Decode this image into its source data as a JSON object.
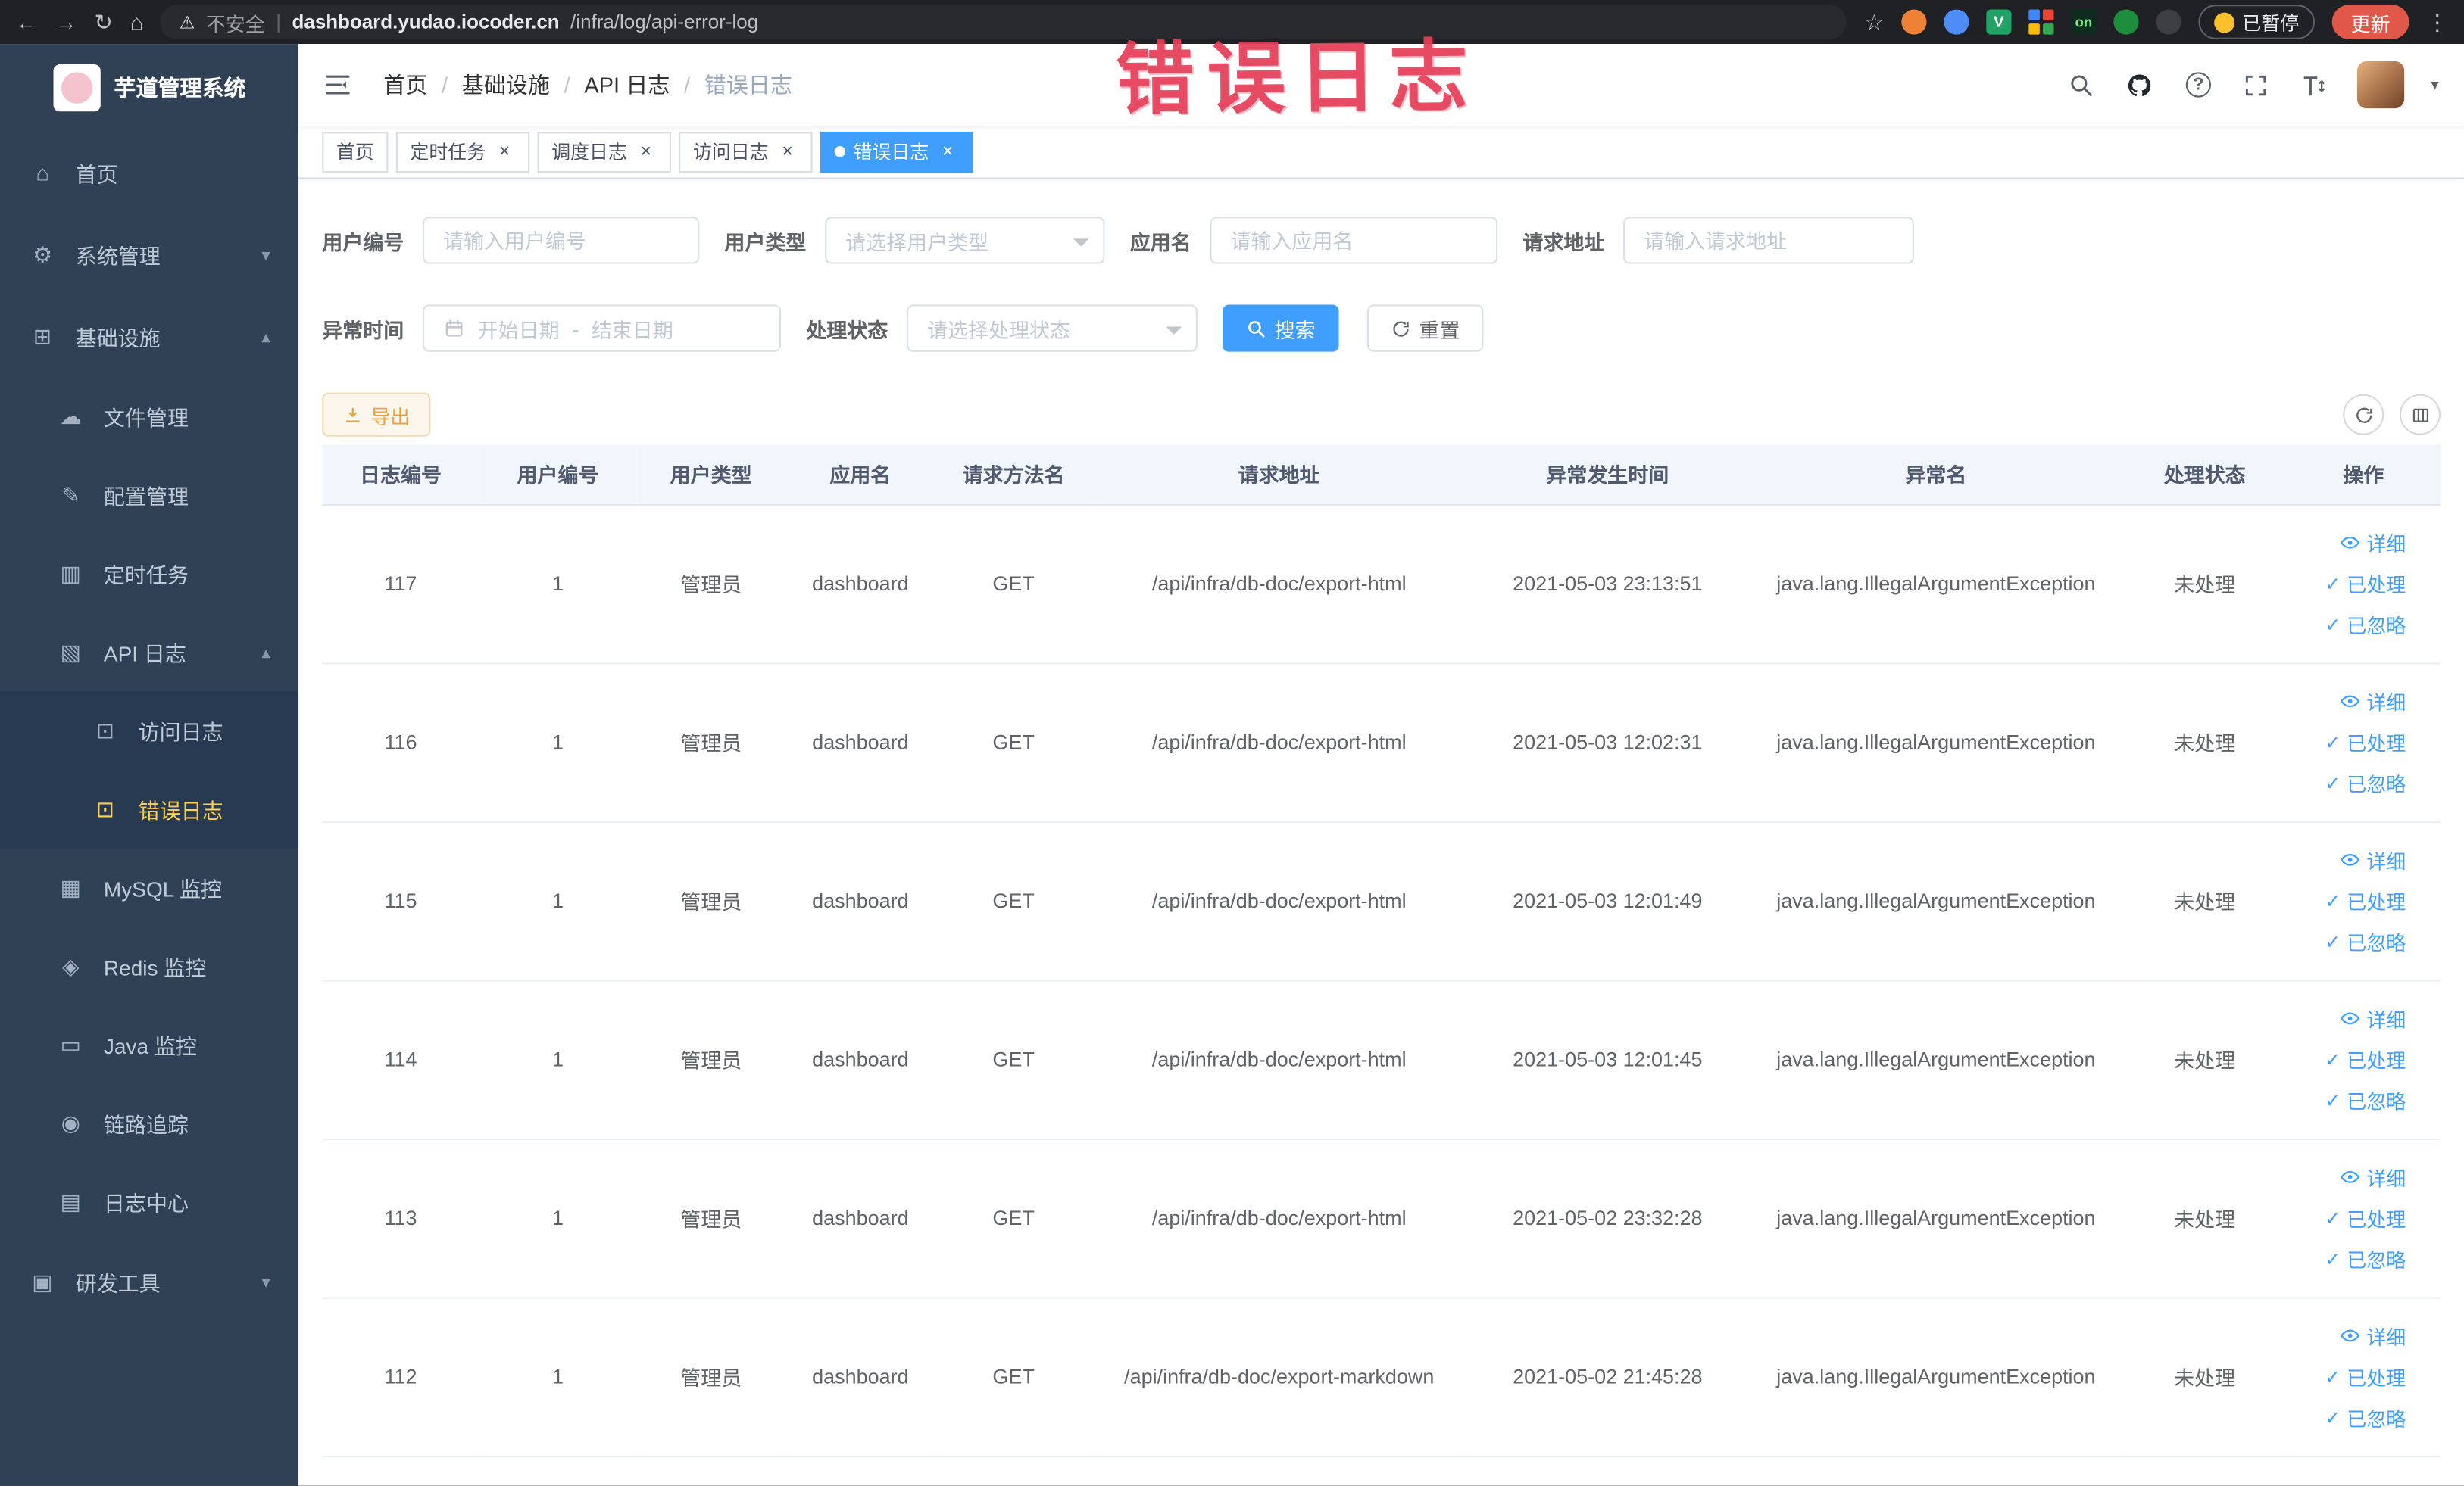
{
  "browser": {
    "security_label": "不安全",
    "divider": "|",
    "url_domain": "dashboard.yudao.iocoder.cn",
    "url_path": "/infra/log/api-error-log",
    "vue_badge": "V",
    "on_badge": "on",
    "paused_badge": "已暂停",
    "update_button": "更新"
  },
  "icons": {
    "back": "←",
    "forward": "→",
    "reload": "↻",
    "home": "⌂",
    "warning": "⚠",
    "star": "☆",
    "more": "⋮",
    "question": "?",
    "chevron_down": "▾",
    "chevron_up": "▴",
    "close": "×",
    "check": "✓",
    "caret_down": "▾",
    "menu_home": "⌂",
    "menu_system": "⚙",
    "menu_infra": "⊞",
    "menu_file": "☁",
    "menu_config": "✎",
    "menu_cron": "▥",
    "menu_api": "▧",
    "menu_doc": "⊡",
    "menu_mysql": "▦",
    "menu_redis": "◈",
    "menu_java": "▭",
    "menu_trace": "◉",
    "menu_log": "▤",
    "menu_dev": "▣"
  },
  "sidebar": {
    "title": "芋道管理系统",
    "items": {
      "home": "首页",
      "system": "系统管理",
      "infra": "基础设施",
      "file": "文件管理",
      "config": "配置管理",
      "cron": "定时任务",
      "api_log": "API 日志",
      "access_log": "访问日志",
      "error_log": "错误日志",
      "mysql": "MySQL 监控",
      "redis": "Redis 监控",
      "java": "Java 监控",
      "trace": "链路追踪",
      "log_center": "日志中心",
      "dev_tools": "研发工具"
    }
  },
  "breadcrumb": {
    "sep": "/",
    "items": [
      "首页",
      "基础设施",
      "API 日志",
      "错误日志"
    ]
  },
  "annotation": {
    "text": "错误日志"
  },
  "tabs": [
    {
      "label": "首页"
    },
    {
      "label": "定时任务"
    },
    {
      "label": "调度日志"
    },
    {
      "label": "访问日志"
    },
    {
      "label": "错误日志"
    }
  ],
  "filters": {
    "user_id_label": "用户编号",
    "user_id_ph": "请输入用户编号",
    "user_type_label": "用户类型",
    "user_type_ph": "请选择用户类型",
    "app_name_label": "应用名",
    "app_name_ph": "请输入应用名",
    "req_url_label": "请求地址",
    "req_url_ph": "请输入请求地址",
    "time_label": "异常时间",
    "time_start_ph": "开始日期",
    "time_sep": "-",
    "time_end_ph": "结束日期",
    "status_label": "处理状态",
    "status_ph": "请选择处理状态",
    "search_label": "搜索",
    "reset_label": "重置"
  },
  "toolbar": {
    "export_label": "导出"
  },
  "table": {
    "columns": [
      "日志编号",
      "用户编号",
      "用户类型",
      "应用名",
      "请求方法名",
      "请求地址",
      "异常发生时间",
      "异常名",
      "处理状态",
      "操作"
    ],
    "rows": [
      {
        "id": "117",
        "user_id": "1",
        "user_type": "管理员",
        "app": "dashboard",
        "method": "GET",
        "url": "/api/infra/db-doc/export-html",
        "time": "2021-05-03 23:13:51",
        "exception": "java.lang.IllegalArgumentException",
        "status": "未处理"
      },
      {
        "id": "116",
        "user_id": "1",
        "user_type": "管理员",
        "app": "dashboard",
        "method": "GET",
        "url": "/api/infra/db-doc/export-html",
        "time": "2021-05-03 12:02:31",
        "exception": "java.lang.IllegalArgumentException",
        "status": "未处理"
      },
      {
        "id": "115",
        "user_id": "1",
        "user_type": "管理员",
        "app": "dashboard",
        "method": "GET",
        "url": "/api/infra/db-doc/export-html",
        "time": "2021-05-03 12:01:49",
        "exception": "java.lang.IllegalArgumentException",
        "status": "未处理"
      },
      {
        "id": "114",
        "user_id": "1",
        "user_type": "管理员",
        "app": "dashboard",
        "method": "GET",
        "url": "/api/infra/db-doc/export-html",
        "time": "2021-05-03 12:01:45",
        "exception": "java.lang.IllegalArgumentException",
        "status": "未处理"
      },
      {
        "id": "113",
        "user_id": "1",
        "user_type": "管理员",
        "app": "dashboard",
        "method": "GET",
        "url": "/api/infra/db-doc/export-html",
        "time": "2021-05-02 23:32:28",
        "exception": "java.lang.IllegalArgumentException",
        "status": "未处理"
      },
      {
        "id": "112",
        "user_id": "1",
        "user_type": "管理员",
        "app": "dashboard",
        "method": "GET",
        "url": "/api/infra/db-doc/export-markdown",
        "time": "2021-05-02 21:45:28",
        "exception": "java.lang.IllegalArgumentException",
        "status": "未处理"
      }
    ]
  },
  "row_actions": [
    "详细",
    "已处理",
    "已忽略"
  ]
}
